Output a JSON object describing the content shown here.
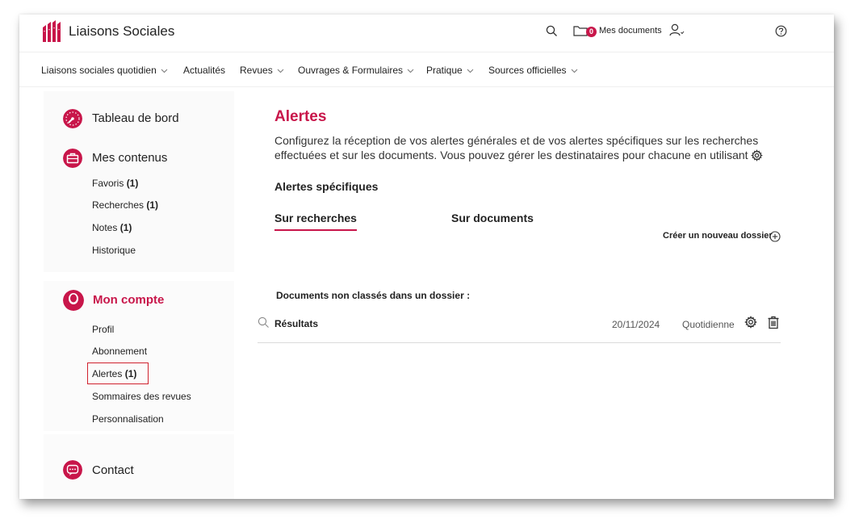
{
  "header": {
    "brand": "Liaisons Sociales",
    "doc_count": "0",
    "docs_label": "Mes documents",
    "icons": [
      "search-icon",
      "folder-icon",
      "user-icon",
      "help-icon"
    ]
  },
  "nav": {
    "items": [
      {
        "label": "Liaisons sociales quotidien",
        "dropdown": true
      },
      {
        "label": "Actualités",
        "dropdown": false
      },
      {
        "label": "Revues",
        "dropdown": true
      },
      {
        "label": "Ouvrages & Formulaires",
        "dropdown": true
      },
      {
        "label": "Pratique",
        "dropdown": true
      },
      {
        "label": "Sources officielles",
        "dropdown": true
      }
    ]
  },
  "sidebar": {
    "dashboard": "Tableau de bord",
    "contents": {
      "title": "Mes contenus",
      "items": [
        {
          "label": "Favoris",
          "count": "(1)"
        },
        {
          "label": "Recherches",
          "count": "(1)"
        },
        {
          "label": "Notes",
          "count": "(1)"
        },
        {
          "label": "Historique",
          "count": ""
        }
      ]
    },
    "account": {
      "title": "Mon compte",
      "items": [
        {
          "label": "Profil",
          "count": ""
        },
        {
          "label": "Abonnement",
          "count": ""
        },
        {
          "label": "Alertes",
          "count": "(1)"
        },
        {
          "label": "Sommaires des revues",
          "count": ""
        },
        {
          "label": "Personnalisation",
          "count": ""
        }
      ]
    },
    "contact": "Contact"
  },
  "main": {
    "title": "Alertes",
    "intro": "Configurez la réception de vos alertes générales et de vos alertes spécifiques sur les recherches effectuées et sur les documents. Vous pouvez gérer les destinataires pour chacune en utilisant",
    "specific_title": "Alertes spécifiques",
    "tabs": [
      "Sur recherches",
      "Sur documents"
    ],
    "create_folder": "Créer un nouveau dossier",
    "unclassified_title": "Documents non classés dans un dossier :",
    "rows": [
      {
        "name": "Résultats",
        "date": "20/11/2024",
        "frequency": "Quotidienne"
      }
    ]
  },
  "colors": {
    "accent": "#c8164a",
    "highlight_box": "#d0222e"
  }
}
